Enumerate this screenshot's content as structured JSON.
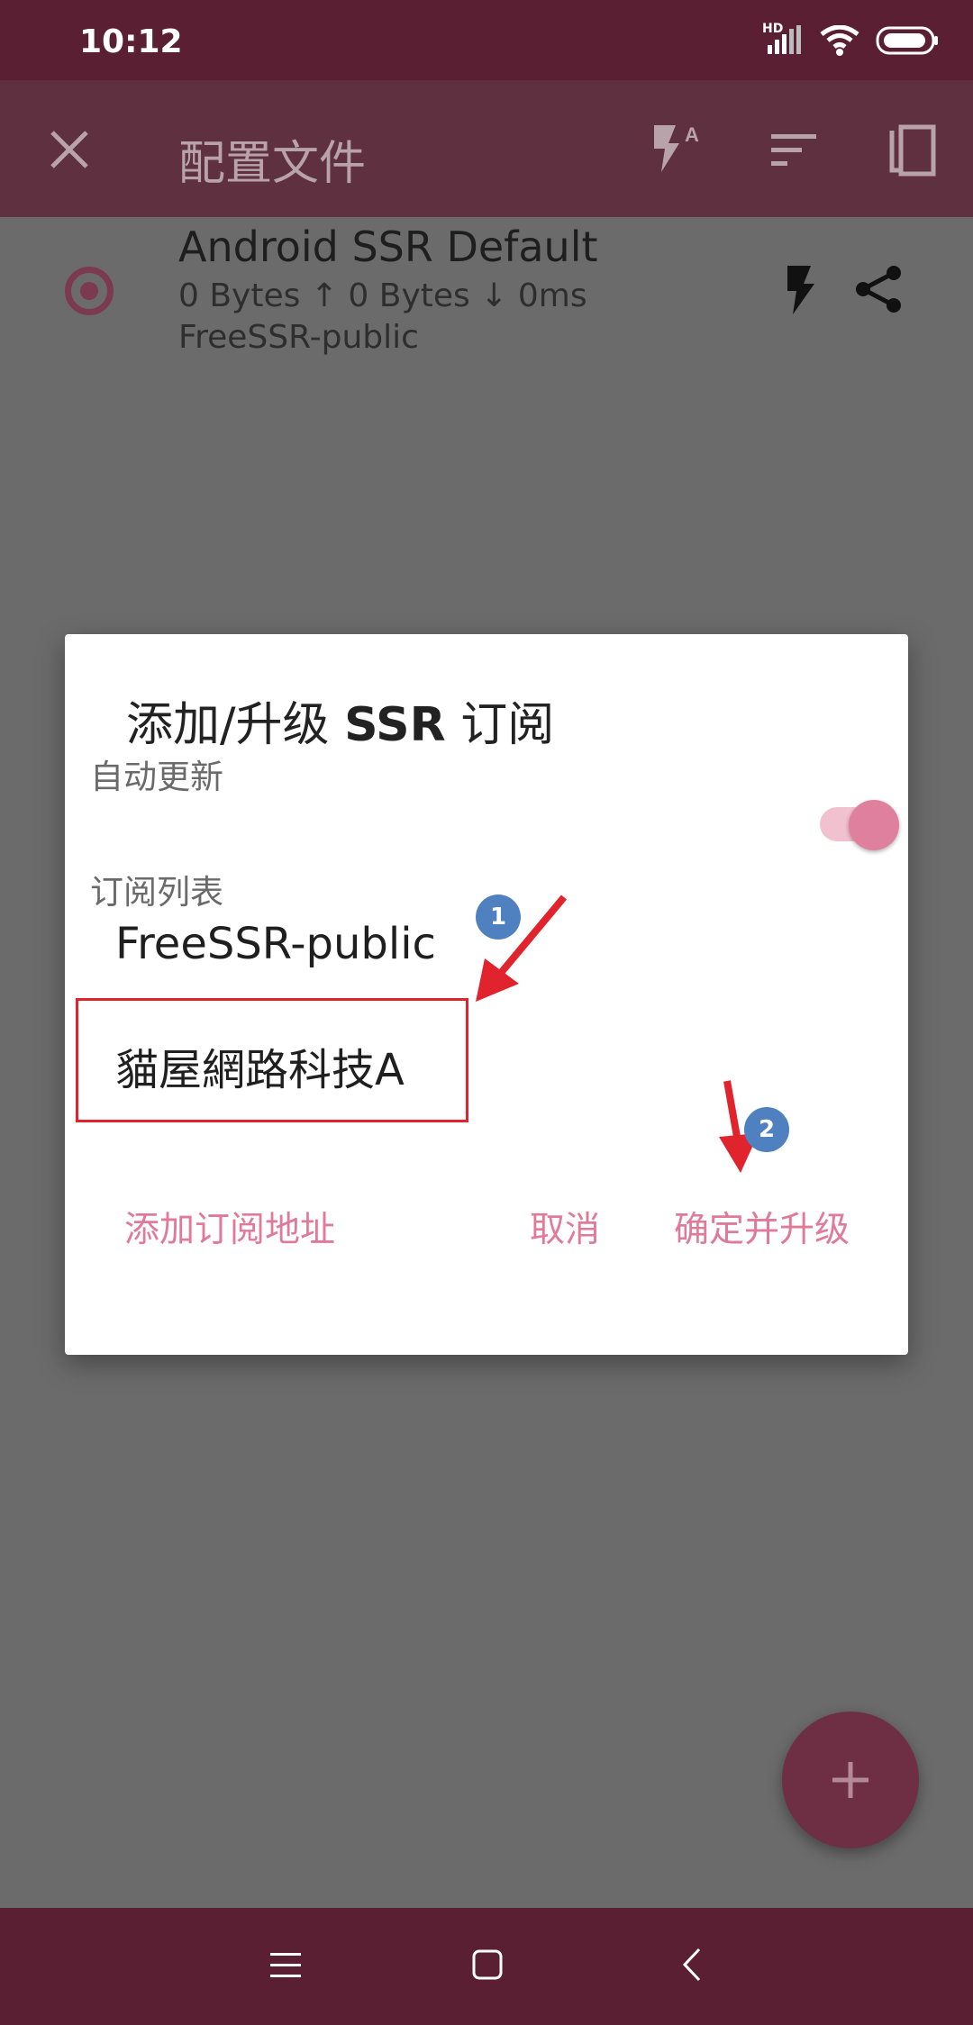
{
  "status_bar": {
    "time": "10:12",
    "network_label": "HD"
  },
  "app_bar": {
    "title": "配置文件"
  },
  "profile": {
    "name": "Android SSR Default",
    "stats": "0 Bytes ↑  0 Bytes ↓  0ms",
    "group": "FreeSSR-public"
  },
  "dialog": {
    "title_prefix": "添加/升级 ",
    "title_bold": "SSR",
    "title_suffix": " 订阅",
    "auto_update_label": "自动更新",
    "auto_update_on": true,
    "subscription_list_label": "订阅列表",
    "subscriptions": [
      "FreeSSR-public",
      "貓屋網路科技A"
    ],
    "add_button": "添加订阅地址",
    "cancel_button": "取消",
    "confirm_button": "确定并升级"
  },
  "annotations": {
    "step1": "1",
    "step2": "2"
  },
  "colors": {
    "status_bar": "#5a1f33",
    "app_bar": "#5e3040",
    "accent": "#e07a98",
    "highlight": "#e1232d",
    "badge": "#4f80c0"
  }
}
